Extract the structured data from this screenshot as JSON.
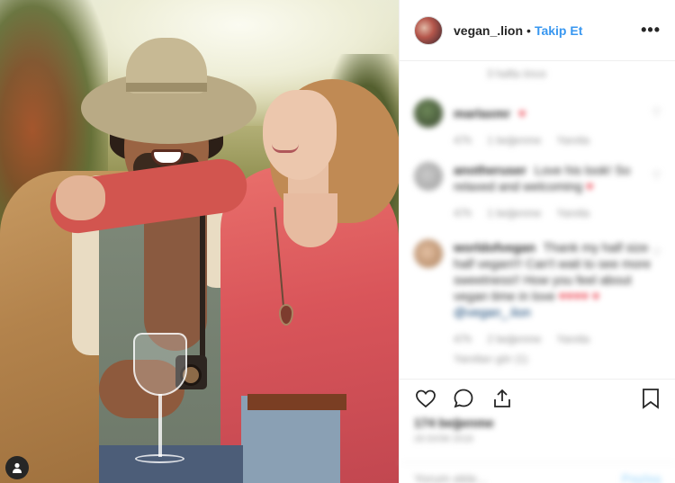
{
  "post": {
    "username": "vegan_.lion",
    "separator": "•",
    "follow_label": "Takip Et",
    "more_label": "•••"
  },
  "comments_panel": {
    "top_meta": "3 hafta önce",
    "comments": [
      {
        "username": "marlaxmr",
        "text": "",
        "heart": "♥",
        "meta_time": "47h",
        "meta_likes": "1 beğenme",
        "meta_reply": "Yanıtla"
      },
      {
        "username": "anotheruser",
        "text": "Love his look! So relaxed and welcoming",
        "heart": "♥",
        "meta_time": "47h",
        "meta_likes": "1 beğenme",
        "meta_reply": "Yanıtla"
      },
      {
        "username": "worldofvegan",
        "text": "Thank my half size half vegan!!! Can't wait to see more sweetness!! How you feel about vegan time in love",
        "hearts": "♥♥♥♥",
        "heart2": "♥",
        "mention": "@vegan_.lion",
        "meta_time": "47h",
        "meta_likes": "2 beğenme",
        "meta_reply": "Yanıtla",
        "meta_replies": "Yanıtları gör (1)"
      }
    ]
  },
  "footer": {
    "likes": "174 beğenme",
    "date": "28 EKİM 2018",
    "add_comment_placeholder": "Yorum ekle...",
    "post_label": "Paylaş"
  },
  "colors": {
    "link": "#3897f0",
    "heart": "#ed4956",
    "text": "#262626",
    "meta": "#8e8e8e"
  },
  "icons": [
    "user-tag-icon",
    "more-icon",
    "heart-icon",
    "comment-icon",
    "share-icon",
    "bookmark-icon"
  ]
}
